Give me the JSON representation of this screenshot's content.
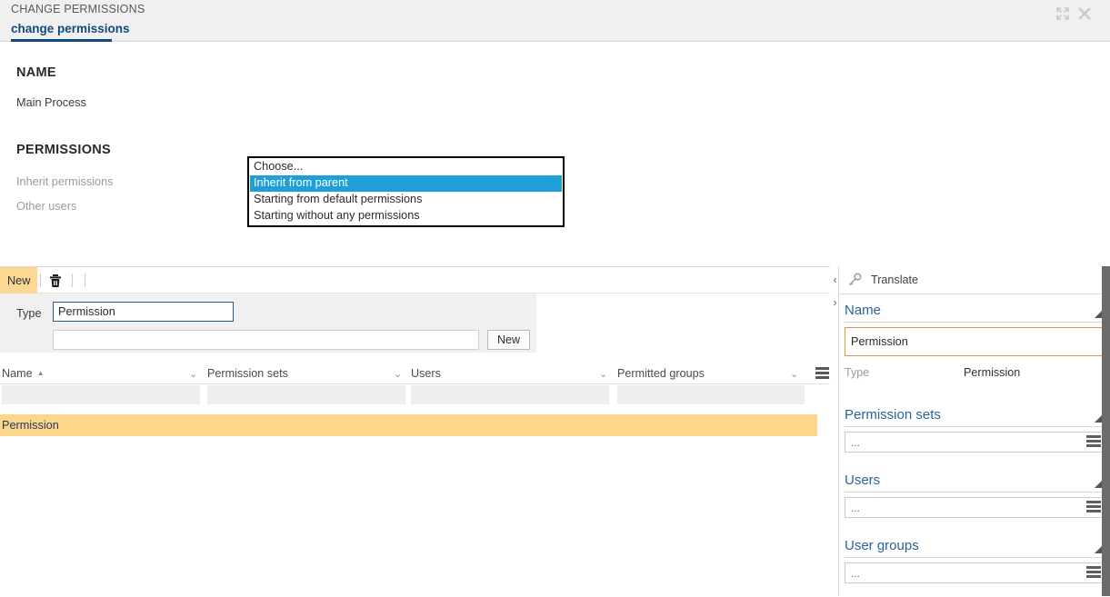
{
  "window": {
    "title": "CHANGE PERMISSIONS",
    "tab_label": "change permissions",
    "maximize_icon": "maximize-icon",
    "close_icon": "close-icon",
    "accent_color": "#10497e",
    "highlight_color": "#fcd894",
    "dropdown_select_color": "#1e9fd8"
  },
  "form": {
    "name_heading": "NAME",
    "name_value": "Main Process",
    "permissions_heading": "PERMISSIONS",
    "inherit_permissions_label": "Inherit permissions",
    "other_users_label": "Other users"
  },
  "dropdown": {
    "options": [
      {
        "label": "Choose...",
        "selected": false
      },
      {
        "label": "Inherit from parent",
        "selected": true
      },
      {
        "label": "Starting from default permissions",
        "selected": false
      },
      {
        "label": "Starting without any permissions",
        "selected": false
      }
    ]
  },
  "toolbar": {
    "new_label": "New",
    "delete_icon": "trash-icon"
  },
  "type_panel": {
    "type_label": "Type",
    "type_value": "Permission",
    "secondary_value": "",
    "secondary_placeholder": "",
    "new_button_label": "New"
  },
  "table": {
    "columns": [
      {
        "label": "Name",
        "sorted": "asc"
      },
      {
        "label": "Permission sets",
        "sorted": ""
      },
      {
        "label": "Users",
        "sorted": ""
      },
      {
        "label": "Permitted groups",
        "sorted": ""
      }
    ],
    "filters": [
      "",
      "",
      "",
      ""
    ],
    "menu_icon": "grid-menu-icon",
    "rows": [
      {
        "name": "Permission",
        "permission_sets": "",
        "users": "",
        "permitted_groups": "",
        "selected": true
      }
    ]
  },
  "splitter": {
    "collapse_right": "‹",
    "collapse_left": "›"
  },
  "right_panel": {
    "translate_label": "Translate",
    "translate_icon": "key-icon",
    "sections": [
      {
        "label": "Name",
        "value": "Permission",
        "placeholder": "",
        "focused": true,
        "picker": false
      },
      {
        "label": "Permission sets",
        "value": "",
        "placeholder": "...",
        "focused": false,
        "picker": true
      },
      {
        "label": "Users",
        "value": "",
        "placeholder": "...",
        "focused": false,
        "picker": true
      },
      {
        "label": "User groups",
        "value": "",
        "placeholder": "...",
        "focused": false,
        "picker": true
      }
    ],
    "type_label": "Type",
    "type_value": "Permission"
  }
}
